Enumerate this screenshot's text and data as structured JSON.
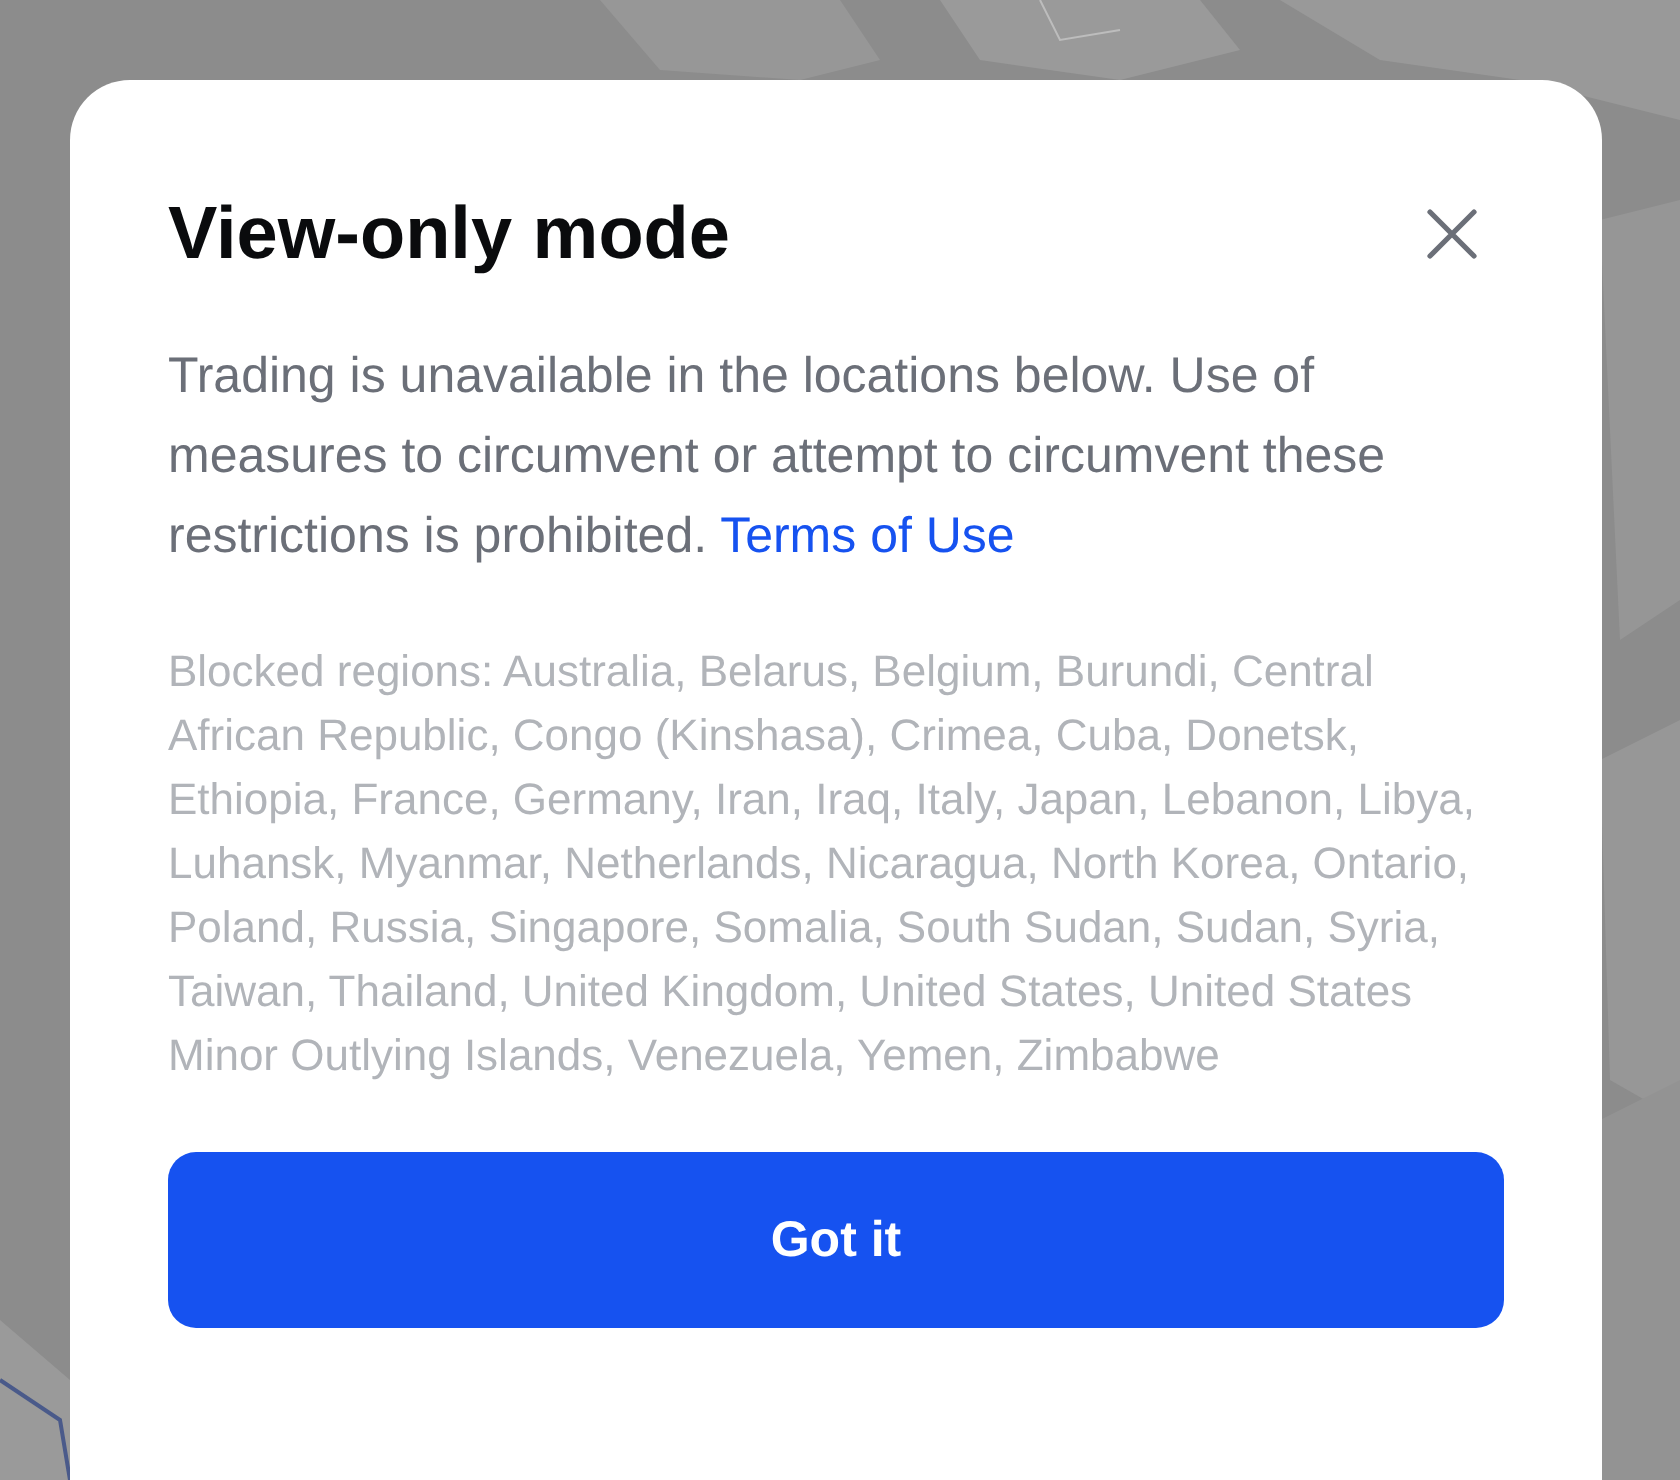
{
  "dialog": {
    "title": "View-only mode",
    "message": "Trading is unavailable in the locations below. Use of measures to circumvent or attempt to circumvent these restrictions is prohibited.",
    "link": "Terms of Use",
    "blocked_regions": "Blocked regions: Australia, Belarus, Belgium, Burundi, Central African Republic, Congo (Kinshasa), Crimea, Cuba, Donetsk, Ethiopia, France, Germany, Iran, Iraq, Italy, Japan, Lebanon, Libya, Luhansk, Myanmar, Netherlands, Nicaragua, North Korea, Ontario, Poland, Russia, Singapore, Somalia, South Sudan, Sudan, Syria, Taiwan, Thailand, United Kingdom, United States, United States Minor Outlying Islands, Venezuela, Yemen, Zimbabwe",
    "button": "Got it"
  }
}
